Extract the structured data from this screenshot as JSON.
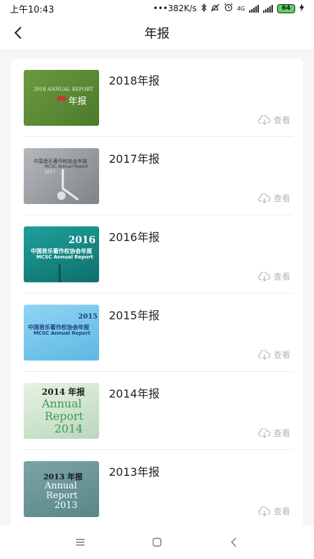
{
  "status_bar": {
    "time": "上午10:43",
    "network_speed": "•••382K/s",
    "network_type": "4G",
    "battery_level": "64"
  },
  "header": {
    "title": "年报",
    "back_icon": "chevron-left-icon"
  },
  "reports": [
    {
      "title": "2018年报",
      "view_label": "查看",
      "cover": {
        "lines": [
          "2018 ANNUAL REPORT",
          "年报"
        ],
        "color": "#5a8a35"
      }
    },
    {
      "title": "2017年报",
      "view_label": "查看",
      "cover": {
        "lines": [
          "中国音乐著作权协会年报",
          "MCSC Annual Report",
          "2017"
        ],
        "color": "#9a9ea3"
      }
    },
    {
      "title": "2016年报",
      "view_label": "查看",
      "cover": {
        "lines": [
          "2016",
          "中国音乐著作权协会年报",
          "MCSC Annual Report"
        ],
        "color": "#1a8f8c"
      }
    },
    {
      "title": "2015年报",
      "view_label": "查看",
      "cover": {
        "lines": [
          "2015",
          "中国音乐著作权协会年报",
          "MCSC Annual Report"
        ],
        "color": "#7cc9ee"
      }
    },
    {
      "title": "2014年报",
      "view_label": "查看",
      "cover": {
        "lines": [
          "2014 年报",
          "Annual",
          "Report",
          "2014"
        ],
        "color": "#cfe3cc"
      }
    },
    {
      "title": "2013年报",
      "view_label": "查看",
      "cover": {
        "lines": [
          "2013 年报",
          "Annual",
          "Report",
          "2013"
        ],
        "color": "#6b9698"
      }
    }
  ],
  "nav_bar": {
    "menu_icon": "menu-icon",
    "home_icon": "home-square-icon",
    "back_icon": "back-triangle-icon"
  },
  "colors": {
    "page_background": "#f6f6f6",
    "card_background": "#ffffff",
    "view_text": "#b6b6b6"
  }
}
